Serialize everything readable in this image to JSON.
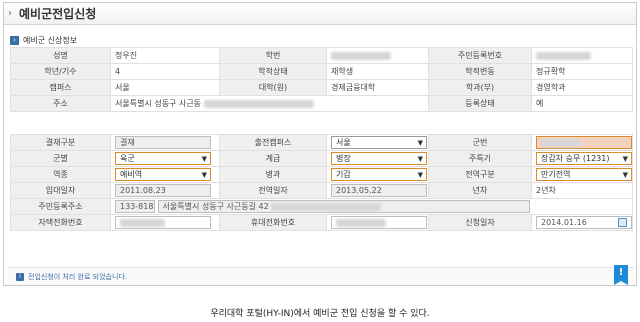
{
  "title": "예비군전입신청",
  "section_label": "예비군 신상정보",
  "personal": {
    "name_label": "성명",
    "name_value": "정우진",
    "student_no_label": "학번",
    "rrn_label": "주민등록번호",
    "grade_label": "학년/기수",
    "grade_value": "4",
    "status_label": "학적상태",
    "status_value": "재학생",
    "change_label": "학적변동",
    "change_value": "정규확학",
    "campus_label": "캠퍼스",
    "campus_value": "서울",
    "college_label": "대학(원)",
    "college_value": "경제금융대학",
    "dept_label": "학과(부)",
    "dept_value": "경영학과",
    "address_label": "주소",
    "address_value": "서울특별시 성동구 사근동",
    "reg_status_label": "등록상태",
    "reg_status_value": "예"
  },
  "application": {
    "settle_label": "결재구분",
    "settle_value": "결재",
    "campus_label": "출전캠퍼스",
    "campus_value": "서울",
    "unit_label": "군번",
    "branch_label": "군별",
    "branch_value": "육군",
    "rank_label": "계급",
    "rank_value": "병장",
    "specialty_label": "주특기",
    "specialty_value": "장갑차 승무 (1231)",
    "type_label": "역종",
    "type_value": "예비역",
    "arm_label": "병과",
    "arm_value": "기갑",
    "transfer_label": "전역구분",
    "transfer_value": "만기전역",
    "enlist_label": "입대일자",
    "enlist_value": "2011.08.23",
    "discharge_label": "전역일자",
    "discharge_value": "2013.05.22",
    "year_label": "년차",
    "year_value": "2년차",
    "addr_label": "주민등록주소",
    "postal_value": "133-818",
    "addr_value": "서울특별시 성동구 사근동길 42",
    "home_phone_label": "자택전화번호",
    "mobile_label": "휴대전화번호",
    "apply_date_label": "신청일자",
    "apply_date_value": "2014.01.16"
  },
  "notice": "전입신청이 처리 완료 되었습니다.",
  "caption": "우리대학 포털(HY-IN)에서 예비군 전입 신청을 할 수 있다.",
  "icons": {
    "title": "chevron-right-icon",
    "section": "arrow-square-icon",
    "notice": "info-icon",
    "bookmark": "bookmark-icon",
    "calendar": "calendar-icon"
  }
}
